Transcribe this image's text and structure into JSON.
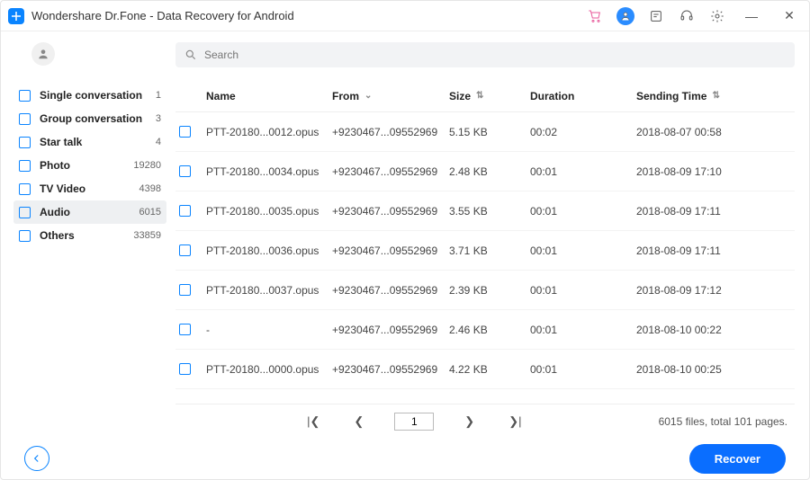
{
  "app": {
    "title": "Wondershare Dr.Fone - Data Recovery for Android"
  },
  "search": {
    "placeholder": "Search"
  },
  "sidebar": {
    "items": [
      {
        "label": "Single conversation",
        "count": "1"
      },
      {
        "label": "Group conversation",
        "count": "3"
      },
      {
        "label": "Star talk",
        "count": "4"
      },
      {
        "label": "Photo",
        "count": "19280"
      },
      {
        "label": "TV Video",
        "count": "4398"
      },
      {
        "label": "Audio",
        "count": "6015"
      },
      {
        "label": "Others",
        "count": "33859"
      }
    ]
  },
  "columns": {
    "name": "Name",
    "from": "From",
    "size": "Size",
    "duration": "Duration",
    "sending": "Sending Time"
  },
  "rows": [
    {
      "name": "PTT-20180...0012.opus",
      "from": "+9230467...09552969",
      "size": "5.15 KB",
      "duration": "00:02",
      "sending": "2018-08-07 00:58"
    },
    {
      "name": "PTT-20180...0034.opus",
      "from": "+9230467...09552969",
      "size": "2.48 KB",
      "duration": "00:01",
      "sending": "2018-08-09 17:10"
    },
    {
      "name": "PTT-20180...0035.opus",
      "from": "+9230467...09552969",
      "size": "3.55 KB",
      "duration": "00:01",
      "sending": "2018-08-09 17:11"
    },
    {
      "name": "PTT-20180...0036.opus",
      "from": "+9230467...09552969",
      "size": "3.71 KB",
      "duration": "00:01",
      "sending": "2018-08-09 17:11"
    },
    {
      "name": "PTT-20180...0037.opus",
      "from": "+9230467...09552969",
      "size": "2.39 KB",
      "duration": "00:01",
      "sending": "2018-08-09 17:12"
    },
    {
      "name": "-",
      "from": "+9230467...09552969",
      "size": "2.46 KB",
      "duration": "00:01",
      "sending": "2018-08-10 00:22"
    },
    {
      "name": "PTT-20180...0000.opus",
      "from": "+9230467...09552969",
      "size": "4.22 KB",
      "duration": "00:01",
      "sending": "2018-08-10 00:25"
    }
  ],
  "pager": {
    "first": "|❮",
    "prev": "❮",
    "page": "1",
    "next": "❯",
    "last": "❯|",
    "summary": "6015 files, total 101 pages."
  },
  "footer": {
    "recover": "Recover"
  }
}
